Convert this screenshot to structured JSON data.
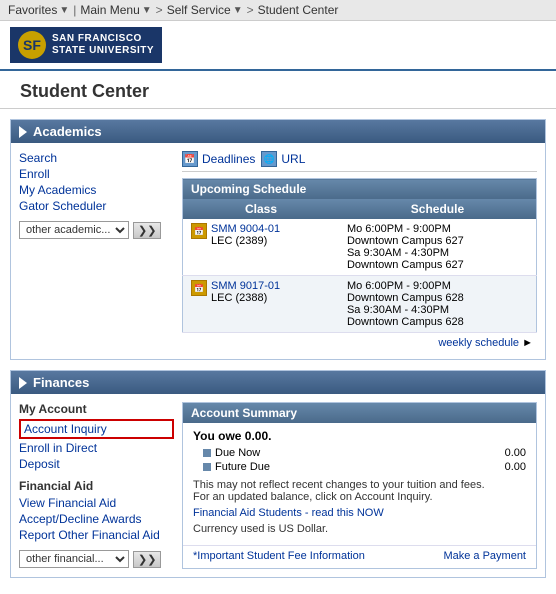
{
  "topnav": {
    "favorites_label": "Favorites",
    "mainmenu_label": "Main Menu",
    "selfservice_label": "Self Service",
    "studentcenter_label": "Student Center"
  },
  "logo": {
    "university_name_line1": "San Francisco",
    "university_name_line2": "State University"
  },
  "page_title": "Student Center",
  "academics_section": {
    "title": "Academics",
    "links": [
      "Search",
      "Enroll",
      "My Academics",
      "Gator Scheduler"
    ],
    "dropdown_default": "other academic...",
    "tabs": [
      {
        "label": "Deadlines",
        "icon": "cal"
      },
      {
        "label": "URL",
        "icon": "url"
      }
    ],
    "schedule_table": {
      "title": "Upcoming Schedule",
      "headers": [
        "Class",
        "Schedule"
      ],
      "rows": [
        {
          "class_code": "SMM 9004-01",
          "class_type": "LEC (2389)",
          "schedule": [
            "Mo 6:00PM - 9:00PM",
            "Downtown Campus 627",
            "Sa 9:30AM - 4:30PM",
            "Downtown Campus 627"
          ]
        },
        {
          "class_code": "SMM 9017-01",
          "class_type": "LEC (2388)",
          "schedule": [
            "Mo 6:00PM - 9:00PM",
            "Downtown Campus 628",
            "Sa 9:30AM - 4:30PM",
            "Downtown Campus 628"
          ]
        }
      ]
    },
    "weekly_schedule_link": "weekly schedule"
  },
  "finances_section": {
    "title": "Finances",
    "my_account_title": "My Account",
    "account_links": [
      "Account Inquiry",
      "Enroll in Direct",
      "Deposit"
    ],
    "financial_aid_title": "Financial Aid",
    "financial_aid_links": [
      "View Financial Aid",
      "Accept/Decline Awards",
      "Report Other Financial Aid"
    ],
    "dropdown_default": "other financial...",
    "account_summary": {
      "title": "Account Summary",
      "you_owe_label": "You owe 0.00.",
      "balances": [
        {
          "label": "Due Now",
          "amount": "0.00"
        },
        {
          "label": "Future Due",
          "amount": "0.00"
        }
      ],
      "notice_text": "This may not reflect recent changes to your tuition and fees.\nFor an updated balance, click on Account Inquiry.",
      "fin_aid_link_text": "Financial Aid Students - read this NOW",
      "currency_note": "Currency used is US Dollar."
    },
    "bottom_links": {
      "left": "*Important Student Fee Information",
      "right": "Make a Payment"
    }
  }
}
